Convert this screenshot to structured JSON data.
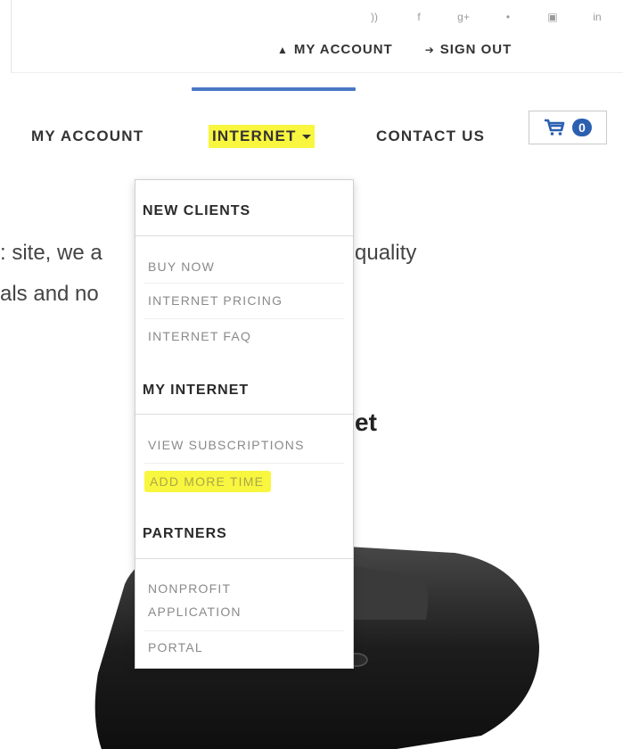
{
  "header": {
    "social_icons": [
      "rss-icon",
      "facebook-icon",
      "google-plus-icon",
      "twitter-icon",
      "youtube-icon",
      "linkedin-icon"
    ],
    "social_glyphs": [
      "))",
      "f",
      "g+",
      "•",
      "▣",
      "in"
    ],
    "account_link": "MY ACCOUNT",
    "signout_link": "SIGN OUT"
  },
  "nav": {
    "my_account": "MY ACCOUNT",
    "internet": "INTERNET",
    "contact_us": "CONTACT US",
    "cart_count": "0",
    "highlight_color": "#f9f63f",
    "active_color": "#4a78c5"
  },
  "page": {
    "text_line1_left": ": site, we a",
    "text_line1_right": "quality",
    "text_line2_left": "als and no",
    "heading_fragment": "et"
  },
  "dropdown": {
    "section1": {
      "heading": "NEW CLIENTS",
      "items": [
        "BUY NOW",
        "INTERNET PRICING",
        "INTERNET FAQ"
      ]
    },
    "section2": {
      "heading": "MY INTERNET",
      "items": [
        "VIEW SUBSCRIPTIONS",
        "ADD MORE TIME"
      ]
    },
    "section3": {
      "heading": "PARTNERS",
      "items": [
        "NONPROFIT",
        "APPLICATION",
        "PORTAL"
      ]
    }
  }
}
